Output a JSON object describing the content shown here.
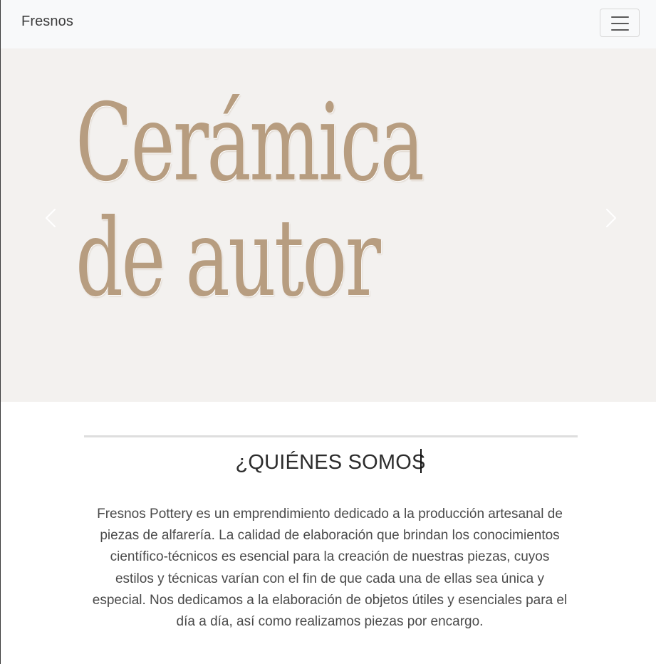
{
  "navbar": {
    "brand": "Fresnos",
    "toggler_icon": "hamburger-menu-icon"
  },
  "hero": {
    "line1": "Cerámica",
    "line2": "de autor",
    "prev_icon": "chevron-left-icon",
    "next_icon": "chevron-right-icon"
  },
  "about": {
    "title": "¿QUIÉNES SOMOS",
    "body": "Fresnos Pottery es un emprendimiento dedicado a la producción artesanal de piezas de alfarería. La calidad de elaboración que brindan los conocimientos científico-técnicos es esencial para la creación de nuestras piezas, cuyos estilos y técnicas varían con el fin de que cada una de ellas sea única y especial. Nos dedicamos a la elaboración de objetos útiles y esenciales para el día a día, así como realizamos piezas por encargo."
  },
  "colors": {
    "navbar_bg": "#f8f9fa",
    "hero_bg": "#f3f1ef",
    "hero_text": "#b79d80",
    "divider": "#dedede"
  }
}
